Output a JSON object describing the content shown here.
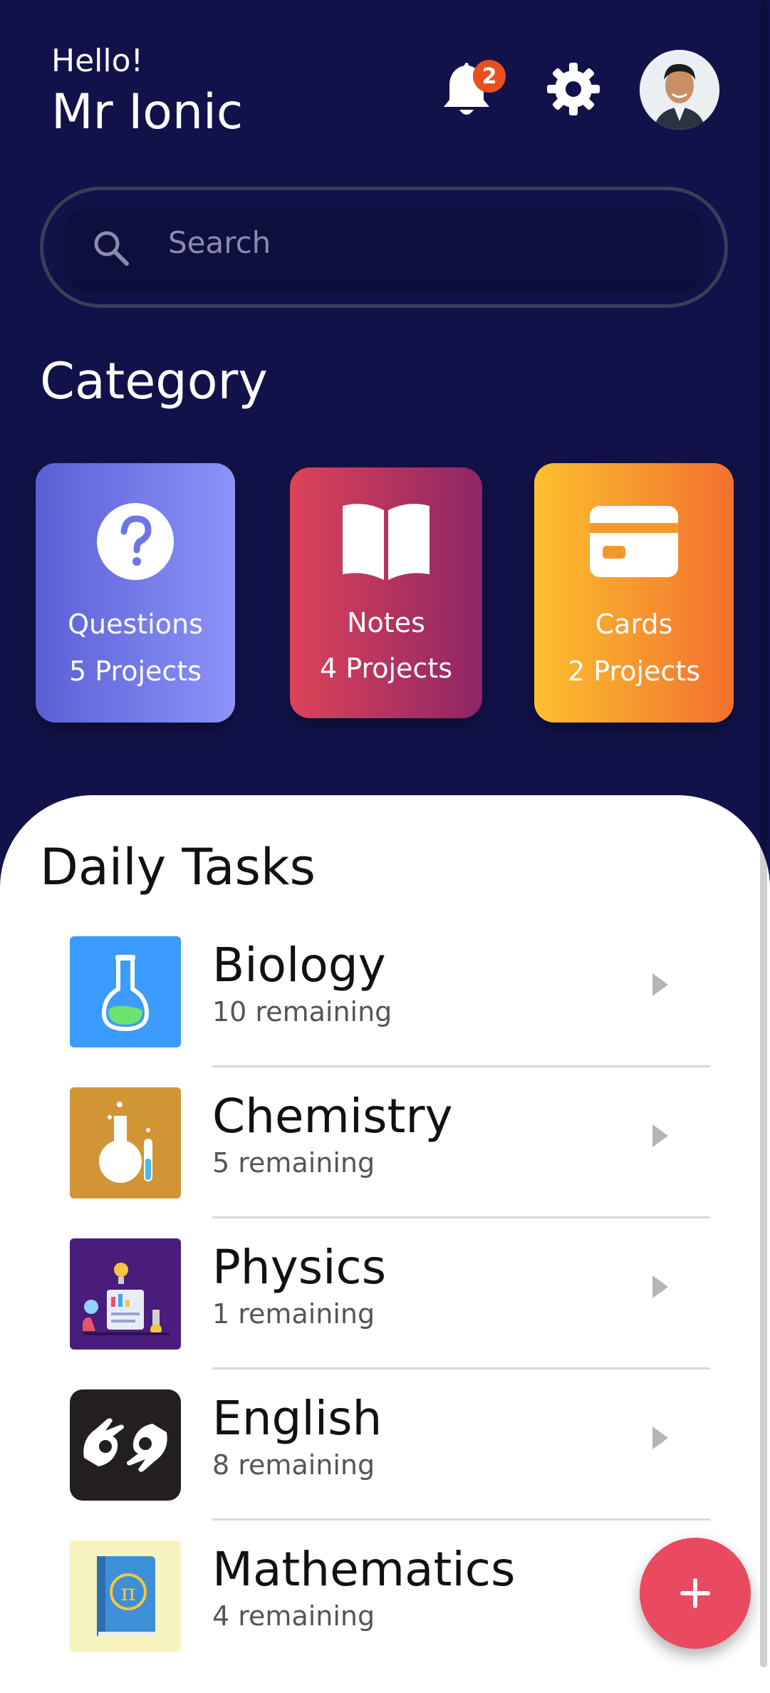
{
  "header": {
    "greeting": "Hello!",
    "name": "Mr Ionic",
    "notification_count": "2",
    "icons": [
      "bell-icon",
      "gear-icon",
      "user-avatar"
    ]
  },
  "search": {
    "placeholder": "Search",
    "icon": "search-icon"
  },
  "category": {
    "title": "Category",
    "cards": [
      {
        "label": "Questions",
        "count": "5 Projects",
        "icon": "question-icon"
      },
      {
        "label": "Notes",
        "count": "4 Projects",
        "icon": "open-book-icon"
      },
      {
        "label": "Cards",
        "count": "2 Projects",
        "icon": "credit-card-icon"
      }
    ]
  },
  "daily_tasks": {
    "title": "Daily Tasks",
    "items": [
      {
        "name": "Biology",
        "remaining": "10 remaining",
        "icon": "flask-icon"
      },
      {
        "name": "Chemistry",
        "remaining": "5 remaining",
        "icon": "lab-flask-icon"
      },
      {
        "name": "Physics",
        "remaining": "1 remaining",
        "icon": "science-lab-icon"
      },
      {
        "name": "English",
        "remaining": "8 remaining",
        "icon": "sign-language-icon"
      },
      {
        "name": "Mathematics",
        "remaining": "4 remaining",
        "icon": "pi-book-icon"
      }
    ]
  },
  "fab": {
    "icon": "plus-icon"
  },
  "colors": {
    "background": "#12124a",
    "questions_card": "#7479ec",
    "notes_card": "#b5345f",
    "cards_card": "#f7962f",
    "fab": "#ea4a60",
    "badge": "#e8511e"
  }
}
